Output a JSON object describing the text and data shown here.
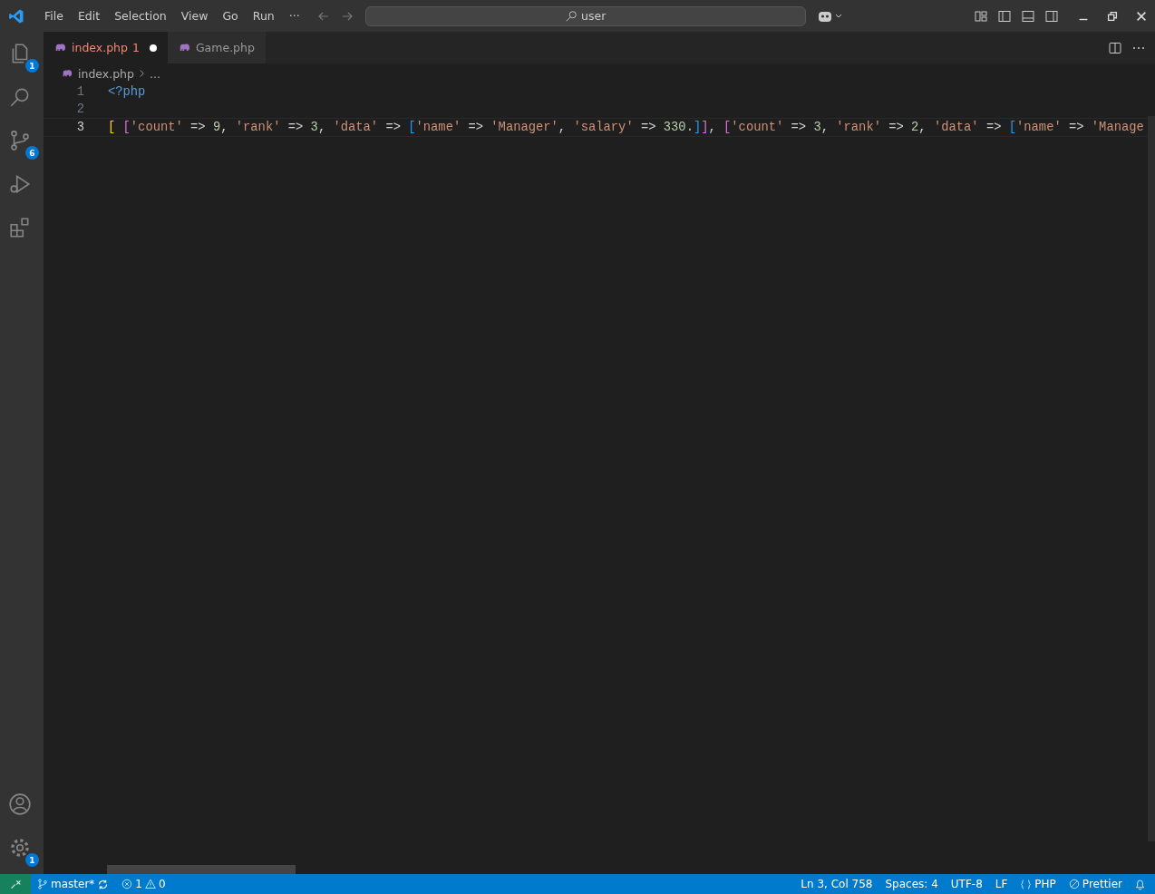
{
  "menu": [
    "File",
    "Edit",
    "Selection",
    "View",
    "Go",
    "Run",
    "···"
  ],
  "command_center": {
    "value": "user"
  },
  "activity_bar": [
    {
      "kind": "files",
      "badge": "1",
      "selected": false
    },
    {
      "kind": "search",
      "selected": false
    },
    {
      "kind": "source-control",
      "badge": "6",
      "selected": false
    },
    {
      "kind": "run-debug",
      "selected": false
    },
    {
      "kind": "extensions",
      "selected": false
    }
  ],
  "activity_bar_bottom": [
    {
      "kind": "account"
    },
    {
      "kind": "settings",
      "badge": "1"
    }
  ],
  "tabs": [
    {
      "label": "index.php",
      "problems": "1",
      "modified": true,
      "selected": true
    },
    {
      "label": "Game.php",
      "modified": false,
      "selected": false
    }
  ],
  "breadcrumb": [
    "index.php",
    "..."
  ],
  "editor": {
    "lines": [
      {
        "number": "1",
        "current": false,
        "tokens": [
          {
            "kind": "tag",
            "text": "<?php"
          }
        ]
      },
      {
        "number": "2",
        "current": false
      },
      {
        "number": "3",
        "current": true,
        "tokens": [
          {
            "kind": "bracket",
            "text": "[ ",
            "color": "#ffd700"
          },
          {
            "kind": "bracket",
            "text": "[",
            "color": "#da70d6"
          },
          {
            "kind": "string",
            "text": "'count'"
          },
          {
            "kind": "plain",
            "text": " => "
          },
          {
            "kind": "number",
            "text": "9"
          },
          {
            "kind": "plain",
            "text": ", "
          },
          {
            "kind": "string",
            "text": "'rank'"
          },
          {
            "kind": "plain",
            "text": " => "
          },
          {
            "kind": "number",
            "text": "3"
          },
          {
            "kind": "plain",
            "text": ", "
          },
          {
            "kind": "string",
            "text": "'data'"
          },
          {
            "kind": "plain",
            "text": " => "
          },
          {
            "kind": "bracket",
            "text": "[",
            "color": "#179fff"
          },
          {
            "kind": "string",
            "text": "'name'"
          },
          {
            "kind": "plain",
            "text": " => "
          },
          {
            "kind": "string",
            "text": "'Manager'"
          },
          {
            "kind": "plain",
            "text": ", "
          },
          {
            "kind": "string",
            "text": "'salary'"
          },
          {
            "kind": "plain",
            "text": " => "
          },
          {
            "kind": "number",
            "text": "330."
          },
          {
            "kind": "bracket",
            "text": "]",
            "color": "#179fff"
          },
          {
            "kind": "bracket",
            "text": "]",
            "color": "#da70d6"
          },
          {
            "kind": "plain",
            "text": ", "
          },
          {
            "kind": "bracket",
            "text": "[",
            "color": "#da70d6"
          },
          {
            "kind": "string",
            "text": "'count'"
          },
          {
            "kind": "plain",
            "text": " => "
          },
          {
            "kind": "number",
            "text": "3"
          },
          {
            "kind": "plain",
            "text": ", "
          },
          {
            "kind": "string",
            "text": "'rank'"
          },
          {
            "kind": "plain",
            "text": " => "
          },
          {
            "kind": "number",
            "text": "2"
          },
          {
            "kind": "plain",
            "text": ", "
          },
          {
            "kind": "string",
            "text": "'data'"
          },
          {
            "kind": "plain",
            "text": " => "
          },
          {
            "kind": "bracket",
            "text": "[",
            "color": "#179fff"
          },
          {
            "kind": "string",
            "text": "'name'"
          },
          {
            "kind": "plain",
            "text": " => "
          },
          {
            "kind": "string",
            "text": "'Manage"
          }
        ]
      }
    ]
  },
  "status_bar": {
    "branch": "master*",
    "errors": "1",
    "warnings": "0",
    "position": "Ln 3, Col 758",
    "spaces": "Spaces: 4",
    "encoding": "UTF-8",
    "eol": "LF",
    "language": "PHP",
    "formatter": "Prettier"
  }
}
